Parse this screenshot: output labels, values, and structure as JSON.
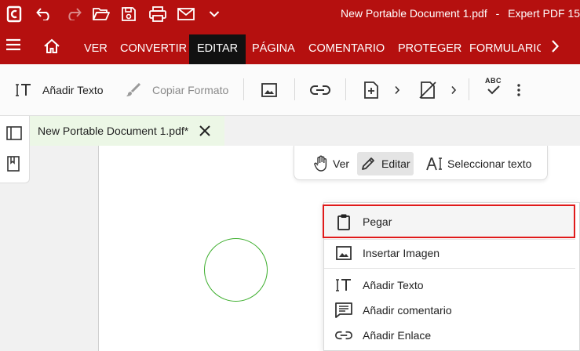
{
  "titlebar": {
    "document_title": "New Portable Document 1.pdf",
    "app_name": "Expert PDF 15",
    "title_separator": "-"
  },
  "ribbon": {
    "tabs": [
      "VER",
      "CONVERTIR",
      "EDITAR",
      "PÁGINA",
      "COMENTARIO",
      "PROTEGER",
      "FORMULARIO"
    ],
    "active_tab": "EDITAR"
  },
  "toolbar": {
    "add_text": "Añadir Texto",
    "copy_format": "Copiar Formato",
    "spell_icon_text": "ABC"
  },
  "doc_tab": {
    "name": "New Portable Document 1.pdf*"
  },
  "modebar": {
    "view": "Ver",
    "edit": "Editar",
    "select_text": "Seleccionar texto",
    "active": "Editar"
  },
  "context_menu": {
    "items": [
      "Pegar",
      "Insertar Imagen",
      "Añadir Texto",
      "Añadir comentario",
      "Añadir Enlace"
    ],
    "highlighted": "Pegar"
  },
  "colors": {
    "brand": "#b5100f",
    "active_tab_bg": "#111111",
    "doc_tab_bg": "#ecf7e6",
    "shape_stroke": "#3cae2c",
    "highlight_outline": "#e01a1a"
  }
}
